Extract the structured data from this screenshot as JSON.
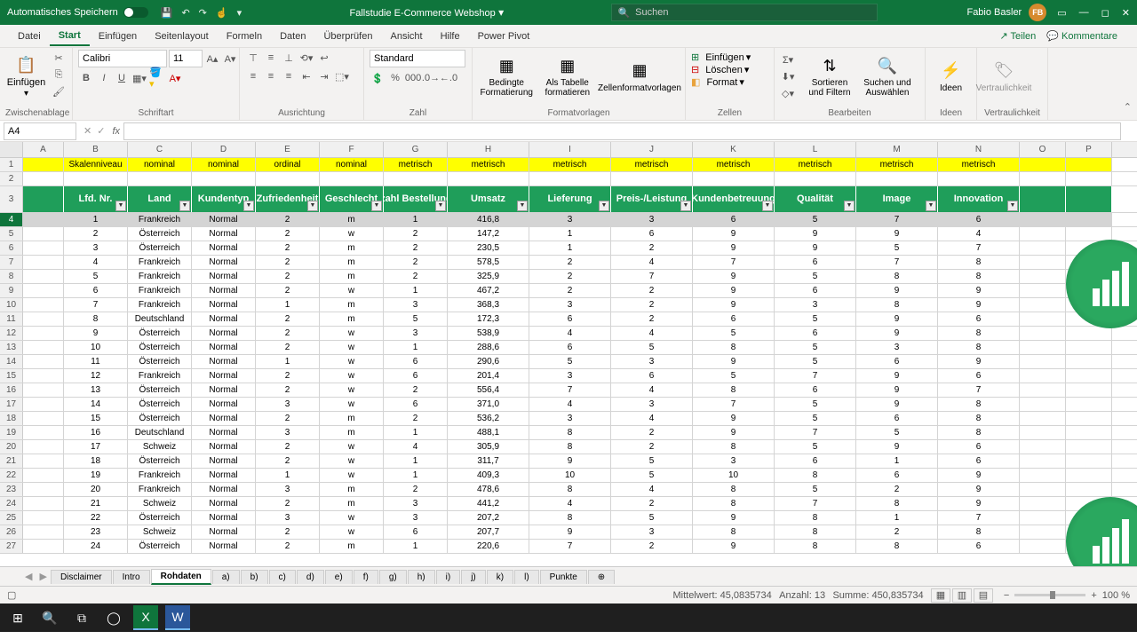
{
  "title": "Fallstudie E-Commerce Webshop",
  "autosave": "Automatisches Speichern",
  "search_placeholder": "Suchen",
  "user": "Fabio Basler",
  "user_initials": "FB",
  "tabs": [
    "Datei",
    "Start",
    "Einfügen",
    "Seitenlayout",
    "Formeln",
    "Daten",
    "Überprüfen",
    "Ansicht",
    "Hilfe",
    "Power Pivot"
  ],
  "active_tab": 1,
  "share": "Teilen",
  "comments": "Kommentare",
  "groups": {
    "clipboard": "Zwischenablage",
    "paste": "Einfügen",
    "font": "Schriftart",
    "font_name": "Calibri",
    "font_size": "11",
    "align": "Ausrichtung",
    "number": "Zahl",
    "number_format": "Standard",
    "styles": "Formatvorlagen",
    "cond": "Bedingte Formatierung",
    "astable": "Als Tabelle formatieren",
    "cellstyles": "Zellenformatvorlagen",
    "cells": "Zellen",
    "insert": "Einfügen",
    "delete": "Löschen",
    "format": "Format",
    "edit": "Bearbeiten",
    "sort": "Sortieren und Filtern",
    "find": "Suchen und Auswählen",
    "ideas": "Ideen",
    "ideas_g": "Ideen",
    "sens": "Vertraulichkeit",
    "sens_g": "Vertraulichkeit"
  },
  "namebox": "A4",
  "cols": [
    "A",
    "B",
    "C",
    "D",
    "E",
    "F",
    "G",
    "H",
    "I",
    "J",
    "K",
    "L",
    "M",
    "N",
    "O",
    "P"
  ],
  "row1_label": "Skalenniveau",
  "row1": [
    "nominal",
    "nominal",
    "ordinal",
    "nominal",
    "metrisch",
    "metrisch",
    "metrisch",
    "metrisch",
    "metrisch",
    "metrisch",
    "metrisch",
    "metrisch"
  ],
  "headers": [
    "Lfd. Nr.",
    "Land",
    "Kundentyp",
    "Zufriedenheit",
    "Geschlecht",
    "Anzahl Bestellungen",
    "Umsatz",
    "Lieferung",
    "Preis-/Leistung",
    "Kundenbetreuung",
    "Qualität",
    "Image",
    "Innovation"
  ],
  "rows": [
    [
      1,
      "Frankreich",
      "Normal",
      2,
      "m",
      1,
      "416,8",
      3,
      3,
      6,
      5,
      7,
      6
    ],
    [
      2,
      "Österreich",
      "Normal",
      2,
      "w",
      2,
      "147,2",
      1,
      6,
      9,
      9,
      9,
      4
    ],
    [
      3,
      "Österreich",
      "Normal",
      2,
      "m",
      2,
      "230,5",
      1,
      2,
      9,
      9,
      5,
      7
    ],
    [
      4,
      "Frankreich",
      "Normal",
      2,
      "m",
      2,
      "578,5",
      2,
      4,
      7,
      6,
      7,
      8
    ],
    [
      5,
      "Frankreich",
      "Normal",
      2,
      "m",
      2,
      "325,9",
      2,
      7,
      9,
      5,
      8,
      8
    ],
    [
      6,
      "Frankreich",
      "Normal",
      2,
      "w",
      1,
      "467,2",
      2,
      2,
      9,
      6,
      9,
      9
    ],
    [
      7,
      "Frankreich",
      "Normal",
      1,
      "m",
      3,
      "368,3",
      3,
      2,
      9,
      3,
      8,
      9
    ],
    [
      8,
      "Deutschland",
      "Normal",
      2,
      "m",
      5,
      "172,3",
      6,
      2,
      6,
      5,
      9,
      6
    ],
    [
      9,
      "Österreich",
      "Normal",
      2,
      "w",
      3,
      "538,9",
      4,
      4,
      5,
      6,
      9,
      8
    ],
    [
      10,
      "Österreich",
      "Normal",
      2,
      "w",
      1,
      "288,6",
      6,
      5,
      8,
      5,
      3,
      8
    ],
    [
      11,
      "Österreich",
      "Normal",
      1,
      "w",
      6,
      "290,6",
      5,
      3,
      9,
      5,
      6,
      9
    ],
    [
      12,
      "Frankreich",
      "Normal",
      2,
      "w",
      6,
      "201,4",
      3,
      6,
      5,
      7,
      9,
      6
    ],
    [
      13,
      "Österreich",
      "Normal",
      2,
      "w",
      2,
      "556,4",
      7,
      4,
      8,
      6,
      9,
      7
    ],
    [
      14,
      "Österreich",
      "Normal",
      3,
      "w",
      6,
      "371,0",
      4,
      3,
      7,
      5,
      9,
      8
    ],
    [
      15,
      "Österreich",
      "Normal",
      2,
      "m",
      2,
      "536,2",
      3,
      4,
      9,
      5,
      6,
      8
    ],
    [
      16,
      "Deutschland",
      "Normal",
      3,
      "m",
      1,
      "488,1",
      8,
      2,
      9,
      7,
      5,
      8
    ],
    [
      17,
      "Schweiz",
      "Normal",
      2,
      "w",
      4,
      "305,9",
      8,
      2,
      8,
      5,
      9,
      6
    ],
    [
      18,
      "Österreich",
      "Normal",
      2,
      "w",
      1,
      "311,7",
      9,
      5,
      3,
      6,
      1,
      6
    ],
    [
      19,
      "Frankreich",
      "Normal",
      1,
      "w",
      1,
      "409,3",
      10,
      5,
      10,
      8,
      6,
      9
    ],
    [
      20,
      "Frankreich",
      "Normal",
      3,
      "m",
      2,
      "478,6",
      8,
      4,
      8,
      5,
      2,
      9
    ],
    [
      21,
      "Schweiz",
      "Normal",
      2,
      "m",
      3,
      "441,2",
      4,
      2,
      8,
      7,
      8,
      9
    ],
    [
      22,
      "Österreich",
      "Normal",
      3,
      "w",
      3,
      "207,2",
      8,
      5,
      9,
      8,
      1,
      7
    ],
    [
      23,
      "Schweiz",
      "Normal",
      2,
      "w",
      6,
      "207,7",
      9,
      3,
      8,
      8,
      2,
      8
    ],
    [
      24,
      "Österreich",
      "Normal",
      2,
      "m",
      1,
      "220,6",
      7,
      2,
      9,
      8,
      8,
      6
    ]
  ],
  "sheet_tabs": [
    "Disclaimer",
    "Intro",
    "Rohdaten",
    "a)",
    "b)",
    "c)",
    "d)",
    "e)",
    "f)",
    "g)",
    "h)",
    "i)",
    "j)",
    "k)",
    "l)",
    "Punkte"
  ],
  "active_sheet": 2,
  "status": {
    "avg": "Mittelwert: 45,0835734",
    "count": "Anzahl: 13",
    "sum": "Summe: 450,835734",
    "zoom": "100 %"
  }
}
